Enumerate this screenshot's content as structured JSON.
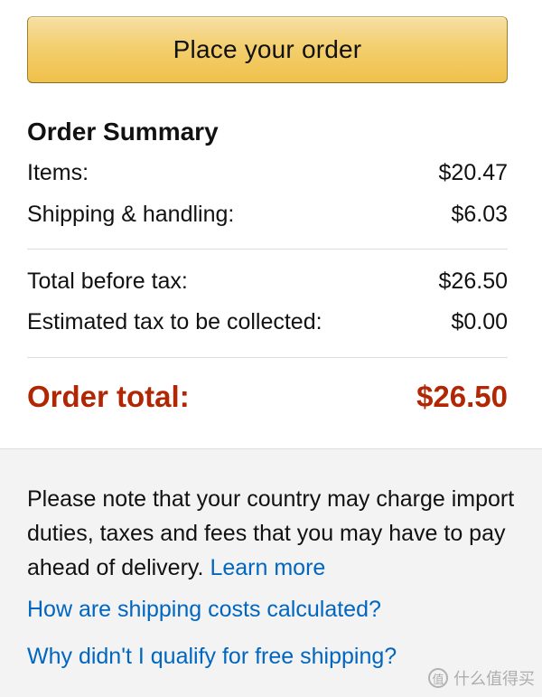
{
  "order_button": {
    "label": "Place your order"
  },
  "summary": {
    "title": "Order Summary",
    "items_label": "Items:",
    "items_value": "$20.47",
    "shipping_label": "Shipping & handling:",
    "shipping_value": "$6.03",
    "before_tax_label": "Total before tax:",
    "before_tax_value": "$26.50",
    "tax_label": "Estimated tax to be collected:",
    "tax_value": "$0.00",
    "total_label": "Order total:",
    "total_value": "$26.50"
  },
  "notice": {
    "text": "Please note that your country may charge import duties, taxes and fees that you may have to pay ahead of delivery.",
    "learn_more": "Learn more"
  },
  "links": {
    "shipping_costs": "How are shipping costs calculated?",
    "free_shipping": "Why didn't I qualify for free shipping?"
  },
  "watermark": {
    "logo_icon": "值",
    "text": "什么值得买"
  },
  "colors": {
    "button_gold": "#f0c14b",
    "total_red": "#b12704",
    "link_blue": "#0066c0",
    "footer_bg": "#f3f3f3"
  }
}
